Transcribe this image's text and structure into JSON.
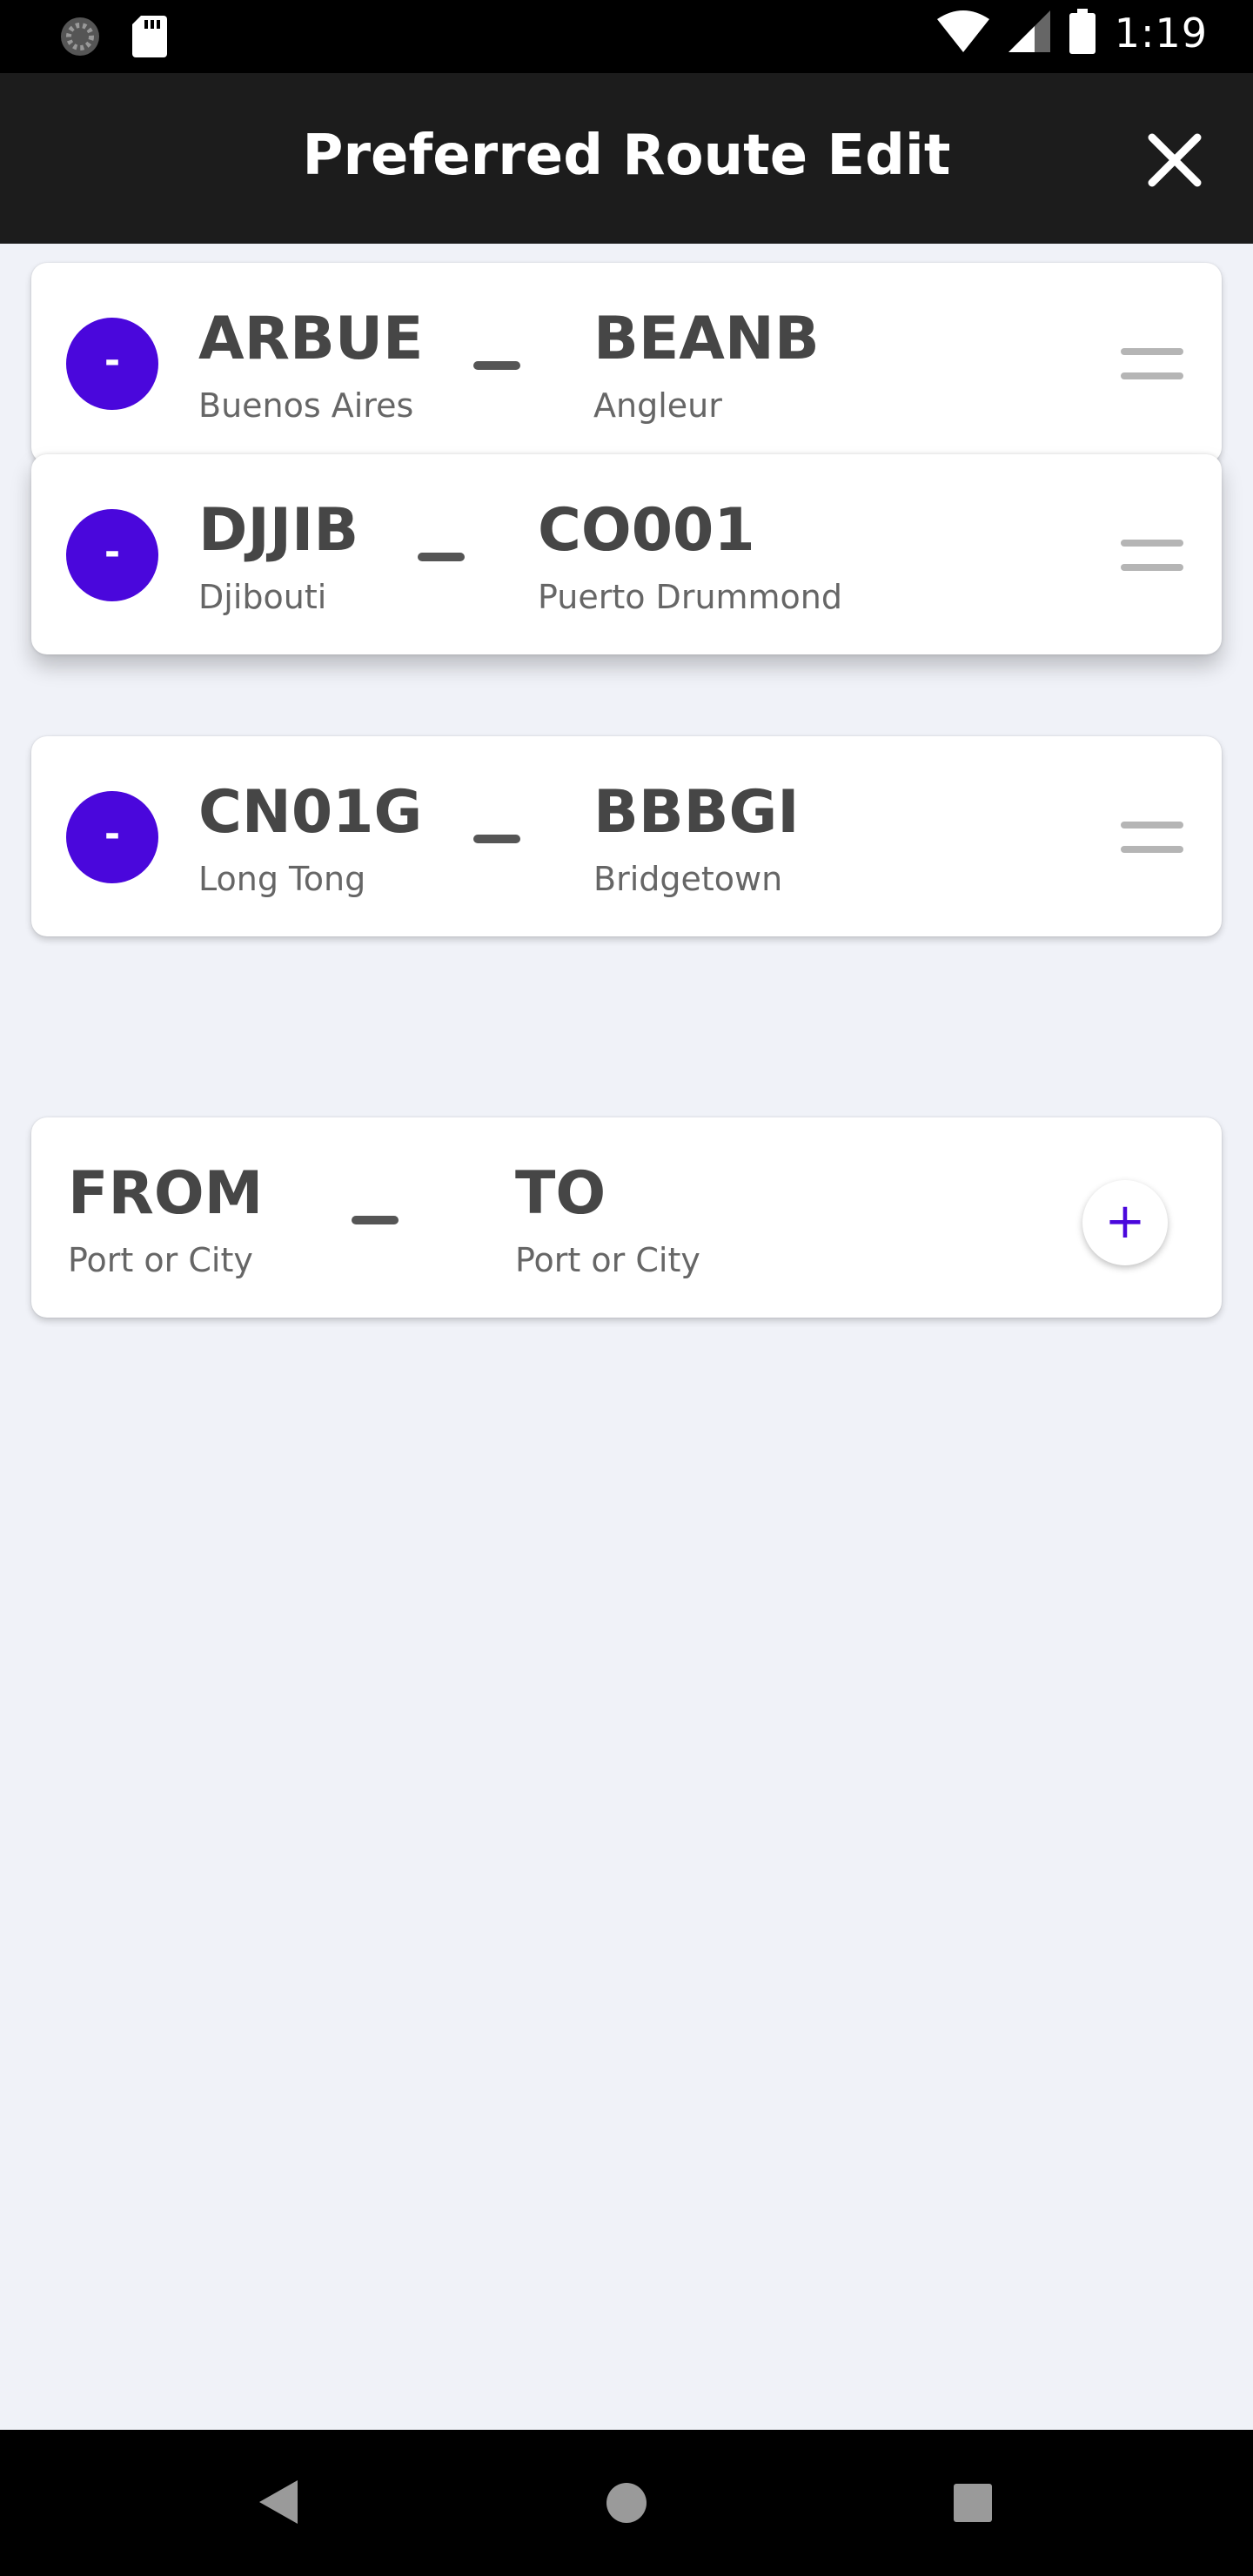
{
  "status_bar": {
    "time": "1:19"
  },
  "header": {
    "title": "Preferred Route Edit"
  },
  "routes": [
    {
      "from_code": "ARBUE",
      "from_city": "Buenos Aires",
      "to_code": "BEANB",
      "to_city": "Angleur",
      "remove_label": "-"
    },
    {
      "from_code": "DJJIB",
      "from_city": "Djibouti",
      "to_code": "CO001",
      "to_city": "Puerto Drummond",
      "remove_label": "-"
    },
    {
      "from_code": "CN01G",
      "from_city": "Long Tong",
      "to_code": "BBBGI",
      "to_city": "Bridgetown",
      "remove_label": "-"
    }
  ],
  "new_route": {
    "from_label": "FROM",
    "from_placeholder": "Port or City",
    "to_label": "TO",
    "to_placeholder": "Port or City",
    "add_label": "+"
  },
  "colors": {
    "accent": "#4a07dc",
    "header_bg": "#1c1c1c",
    "page_bg": "#f0f2f8"
  }
}
